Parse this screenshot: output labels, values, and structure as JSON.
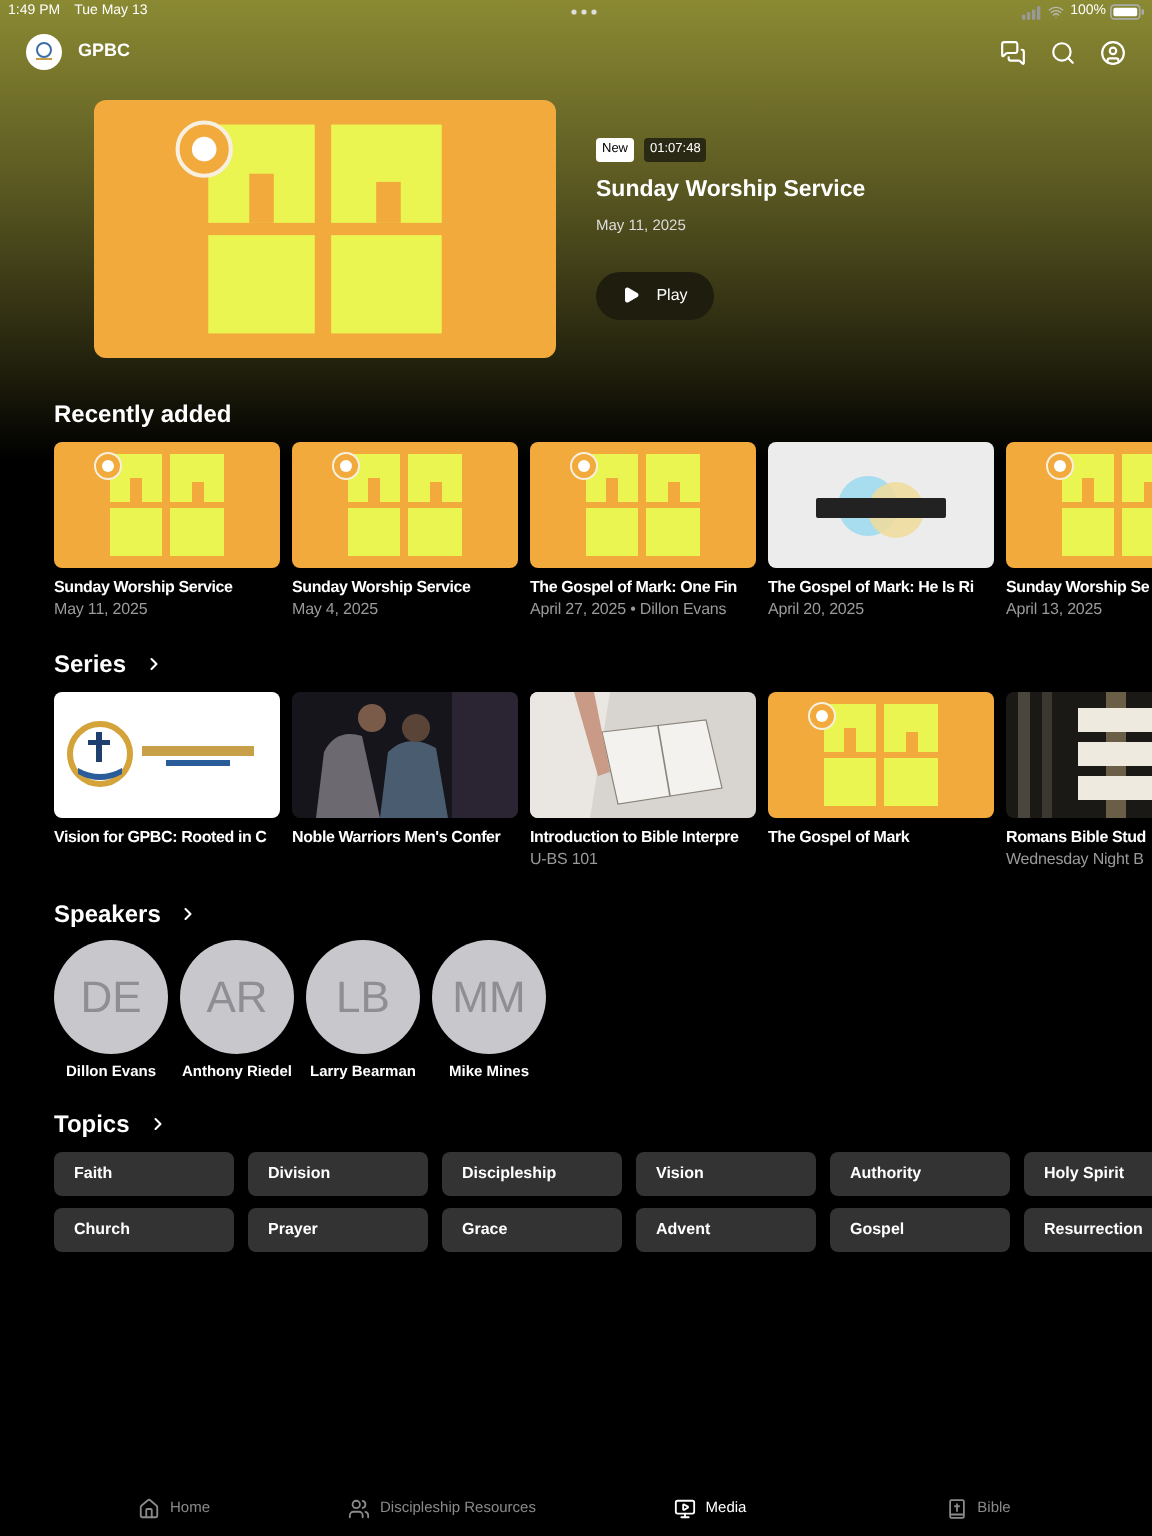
{
  "status_bar": {
    "time": "1:49 PM",
    "date": "Tue May 13",
    "battery": "100%"
  },
  "header": {
    "title": "GPBC"
  },
  "featured": {
    "badge": "New",
    "duration": "01:07:48",
    "title": "Sunday Worship Service",
    "date": "May 11, 2025",
    "play_label": "Play"
  },
  "recently_added": {
    "title": "Recently added",
    "items": [
      {
        "title": "Sunday Worship Service",
        "subtitle": "May 11, 2025"
      },
      {
        "title": "Sunday Worship Service",
        "subtitle": "May 4, 2025"
      },
      {
        "title": "The Gospel of Mark: One Fin",
        "subtitle": "April 27, 2025 • Dillon Evans"
      },
      {
        "title": "The Gospel of Mark: He Is Ri",
        "subtitle": "April 20, 2025"
      },
      {
        "title": "Sunday Worship Se",
        "subtitle": "April 13, 2025"
      }
    ]
  },
  "series": {
    "title": "Series",
    "items": [
      {
        "title": "Vision for GPBC: Rooted in C"
      },
      {
        "title": "Noble Warriors Men's Confer"
      },
      {
        "title": "Introduction to Bible Interpre",
        "subtitle": "U-BS 101"
      },
      {
        "title": "The Gospel of Mark"
      },
      {
        "title": "Romans Bible Stud",
        "subtitle": "Wednesday Night B"
      }
    ]
  },
  "speakers": {
    "title": "Speakers",
    "items": [
      {
        "initials": "DE",
        "name": "Dillon Evans"
      },
      {
        "initials": "AR",
        "name": "Anthony Riedel"
      },
      {
        "initials": "LB",
        "name": "Larry Bearman"
      },
      {
        "initials": "MM",
        "name": "Mike Mines"
      }
    ]
  },
  "topics": {
    "title": "Topics",
    "items": [
      "Faith",
      "Division",
      "Discipleship",
      "Vision",
      "Authority",
      "Holy Spirit",
      "Church",
      "Prayer",
      "Grace",
      "Advent",
      "Gospel",
      "Resurrection"
    ]
  },
  "tab_bar": [
    {
      "label": "Home",
      "selected": false
    },
    {
      "label": "Discipleship Resources",
      "selected": false
    },
    {
      "label": "Media",
      "selected": true
    },
    {
      "label": "Bible",
      "selected": false
    }
  ]
}
